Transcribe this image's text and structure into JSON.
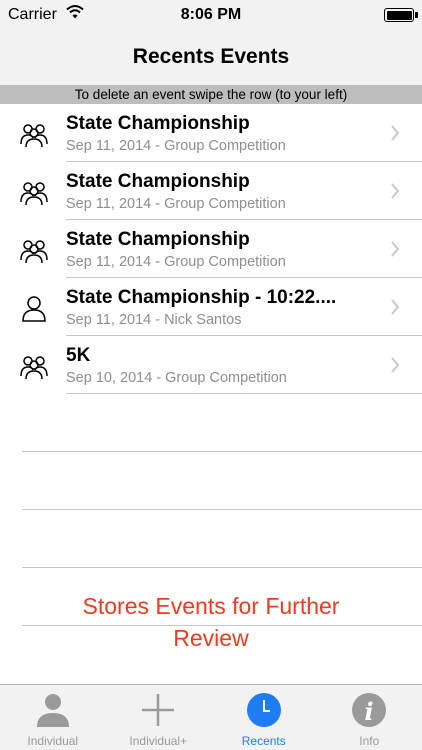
{
  "status_bar": {
    "carrier": "Carrier",
    "time": "8:06 PM"
  },
  "nav": {
    "title": "Recents Events"
  },
  "hint": "To delete an event swipe the row (to your left)",
  "events": [
    {
      "title": "State Championship",
      "subtitle": "Sep 11, 2014 - Group Competition",
      "icon": "group-icon"
    },
    {
      "title": "State Championship",
      "subtitle": "Sep 11, 2014 - Group Competition",
      "icon": "group-icon"
    },
    {
      "title": "State Championship",
      "subtitle": "Sep 11, 2014 - Group Competition",
      "icon": "group-icon"
    },
    {
      "title": "State Championship  - 10:22....",
      "subtitle": "Sep 11, 2014 - Nick Santos",
      "icon": "person-icon"
    },
    {
      "title": "5K",
      "subtitle": "Sep 10, 2014 - Group Competition",
      "icon": "group-icon"
    }
  ],
  "promo": {
    "line1": "Stores Events for Further",
    "line2": "Review"
  },
  "tabs": [
    {
      "label": "Individual",
      "icon": "person-icon",
      "active": false
    },
    {
      "label": "Individual+",
      "icon": "plus-icon",
      "active": false
    },
    {
      "label": "Recents",
      "icon": "clock-icon",
      "active": true
    },
    {
      "label": "Info",
      "icon": "info-icon",
      "active": false
    }
  ],
  "colors": {
    "accent": "#1f7cf2",
    "promo": "#f03c1e",
    "hint_bg": "#bdbdbd",
    "bar_bg": "#f2f2f2"
  }
}
